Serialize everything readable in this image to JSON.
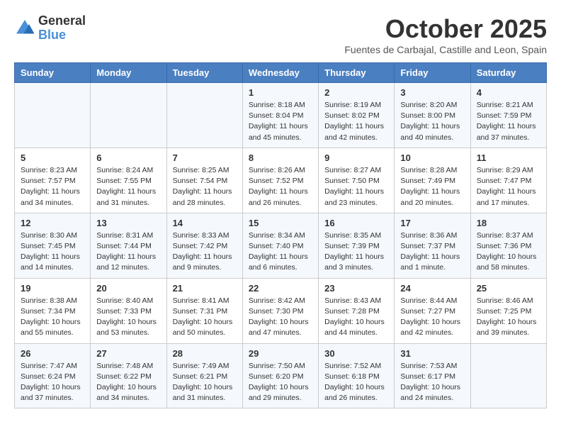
{
  "header": {
    "logo_line1": "General",
    "logo_line2": "Blue",
    "month": "October 2025",
    "location": "Fuentes de Carbajal, Castille and Leon, Spain"
  },
  "weekdays": [
    "Sunday",
    "Monday",
    "Tuesday",
    "Wednesday",
    "Thursday",
    "Friday",
    "Saturday"
  ],
  "rows": [
    [
      {
        "day": "",
        "info": ""
      },
      {
        "day": "",
        "info": ""
      },
      {
        "day": "",
        "info": ""
      },
      {
        "day": "1",
        "info": "Sunrise: 8:18 AM\nSunset: 8:04 PM\nDaylight: 11 hours\nand 45 minutes."
      },
      {
        "day": "2",
        "info": "Sunrise: 8:19 AM\nSunset: 8:02 PM\nDaylight: 11 hours\nand 42 minutes."
      },
      {
        "day": "3",
        "info": "Sunrise: 8:20 AM\nSunset: 8:00 PM\nDaylight: 11 hours\nand 40 minutes."
      },
      {
        "day": "4",
        "info": "Sunrise: 8:21 AM\nSunset: 7:59 PM\nDaylight: 11 hours\nand 37 minutes."
      }
    ],
    [
      {
        "day": "5",
        "info": "Sunrise: 8:23 AM\nSunset: 7:57 PM\nDaylight: 11 hours\nand 34 minutes."
      },
      {
        "day": "6",
        "info": "Sunrise: 8:24 AM\nSunset: 7:55 PM\nDaylight: 11 hours\nand 31 minutes."
      },
      {
        "day": "7",
        "info": "Sunrise: 8:25 AM\nSunset: 7:54 PM\nDaylight: 11 hours\nand 28 minutes."
      },
      {
        "day": "8",
        "info": "Sunrise: 8:26 AM\nSunset: 7:52 PM\nDaylight: 11 hours\nand 26 minutes."
      },
      {
        "day": "9",
        "info": "Sunrise: 8:27 AM\nSunset: 7:50 PM\nDaylight: 11 hours\nand 23 minutes."
      },
      {
        "day": "10",
        "info": "Sunrise: 8:28 AM\nSunset: 7:49 PM\nDaylight: 11 hours\nand 20 minutes."
      },
      {
        "day": "11",
        "info": "Sunrise: 8:29 AM\nSunset: 7:47 PM\nDaylight: 11 hours\nand 17 minutes."
      }
    ],
    [
      {
        "day": "12",
        "info": "Sunrise: 8:30 AM\nSunset: 7:45 PM\nDaylight: 11 hours\nand 14 minutes."
      },
      {
        "day": "13",
        "info": "Sunrise: 8:31 AM\nSunset: 7:44 PM\nDaylight: 11 hours\nand 12 minutes."
      },
      {
        "day": "14",
        "info": "Sunrise: 8:33 AM\nSunset: 7:42 PM\nDaylight: 11 hours\nand 9 minutes."
      },
      {
        "day": "15",
        "info": "Sunrise: 8:34 AM\nSunset: 7:40 PM\nDaylight: 11 hours\nand 6 minutes."
      },
      {
        "day": "16",
        "info": "Sunrise: 8:35 AM\nSunset: 7:39 PM\nDaylight: 11 hours\nand 3 minutes."
      },
      {
        "day": "17",
        "info": "Sunrise: 8:36 AM\nSunset: 7:37 PM\nDaylight: 11 hours\nand 1 minute."
      },
      {
        "day": "18",
        "info": "Sunrise: 8:37 AM\nSunset: 7:36 PM\nDaylight: 10 hours\nand 58 minutes."
      }
    ],
    [
      {
        "day": "19",
        "info": "Sunrise: 8:38 AM\nSunset: 7:34 PM\nDaylight: 10 hours\nand 55 minutes."
      },
      {
        "day": "20",
        "info": "Sunrise: 8:40 AM\nSunset: 7:33 PM\nDaylight: 10 hours\nand 53 minutes."
      },
      {
        "day": "21",
        "info": "Sunrise: 8:41 AM\nSunset: 7:31 PM\nDaylight: 10 hours\nand 50 minutes."
      },
      {
        "day": "22",
        "info": "Sunrise: 8:42 AM\nSunset: 7:30 PM\nDaylight: 10 hours\nand 47 minutes."
      },
      {
        "day": "23",
        "info": "Sunrise: 8:43 AM\nSunset: 7:28 PM\nDaylight: 10 hours\nand 44 minutes."
      },
      {
        "day": "24",
        "info": "Sunrise: 8:44 AM\nSunset: 7:27 PM\nDaylight: 10 hours\nand 42 minutes."
      },
      {
        "day": "25",
        "info": "Sunrise: 8:46 AM\nSunset: 7:25 PM\nDaylight: 10 hours\nand 39 minutes."
      }
    ],
    [
      {
        "day": "26",
        "info": "Sunrise: 7:47 AM\nSunset: 6:24 PM\nDaylight: 10 hours\nand 37 minutes."
      },
      {
        "day": "27",
        "info": "Sunrise: 7:48 AM\nSunset: 6:22 PM\nDaylight: 10 hours\nand 34 minutes."
      },
      {
        "day": "28",
        "info": "Sunrise: 7:49 AM\nSunset: 6:21 PM\nDaylight: 10 hours\nand 31 minutes."
      },
      {
        "day": "29",
        "info": "Sunrise: 7:50 AM\nSunset: 6:20 PM\nDaylight: 10 hours\nand 29 minutes."
      },
      {
        "day": "30",
        "info": "Sunrise: 7:52 AM\nSunset: 6:18 PM\nDaylight: 10 hours\nand 26 minutes."
      },
      {
        "day": "31",
        "info": "Sunrise: 7:53 AM\nSunset: 6:17 PM\nDaylight: 10 hours\nand 24 minutes."
      },
      {
        "day": "",
        "info": ""
      }
    ]
  ]
}
